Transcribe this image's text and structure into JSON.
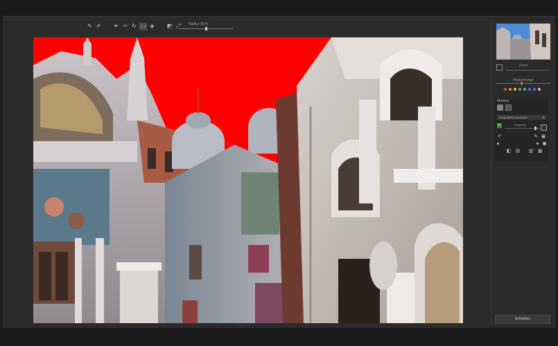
{
  "toolbar": {
    "tools": [
      "brush-icon",
      "brush-plus-icon",
      "pen-icon",
      "pen-minus-icon",
      "refresh-icon",
      "eraser-icon",
      "select-icon",
      "invert-icon",
      "fill-icon",
      "clear-icon"
    ],
    "slider_label": "Radius 30 %",
    "slider_value": 0.5
  },
  "navigator": {
    "zoom_label": "Zoom",
    "zoom_value": 0.2
  },
  "mask_range": {
    "label": "Maskenrange",
    "value": 0.45,
    "colors": [
      "#d9534f",
      "#e8894a",
      "#e8c84a",
      "#5cb85c",
      "#4ab8b8",
      "#4a7ae8",
      "#8a4ae8",
      "#cccccc"
    ]
  },
  "masks": {
    "title": "Masken",
    "mode_select": "Sergeabbild anwenden",
    "opacity_label": "Deckkraft",
    "opacity_value": 0.85
  },
  "apply_button": "Schließen",
  "colors": {
    "sky": "#ff0000",
    "accent": "#3b8d3b",
    "panel": "#2b2b2b"
  }
}
